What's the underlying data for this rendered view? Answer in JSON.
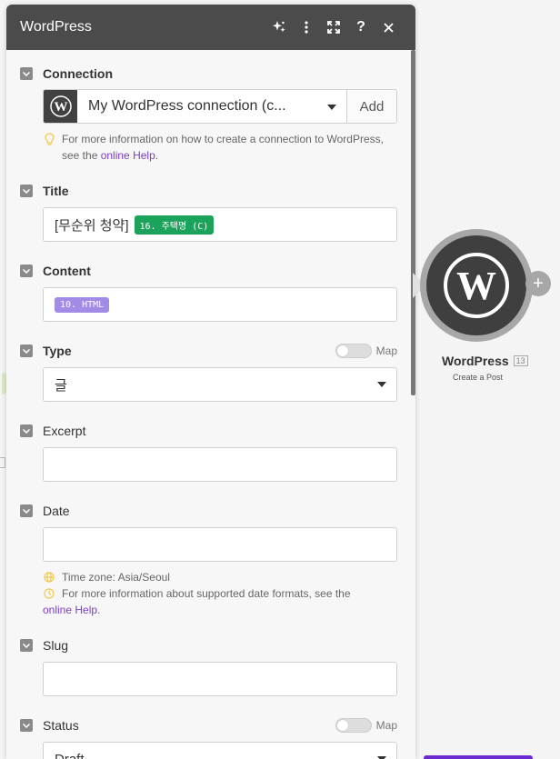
{
  "panel": {
    "title": "WordPress"
  },
  "connection": {
    "label": "Connection",
    "value": "My WordPress connection (c...",
    "add_label": "Add",
    "hint_text": "For more information on how to create a connection to WordPress, see the ",
    "hint_link": "online Help",
    "hint_end": "."
  },
  "title_field": {
    "label": "Title",
    "text": "[무순위 청약]",
    "pill": "16. 주택명 (C)"
  },
  "content_field": {
    "label": "Content",
    "pill": "10. HTML"
  },
  "type_field": {
    "label": "Type",
    "map_label": "Map",
    "value": "글"
  },
  "excerpt_field": {
    "label": "Excerpt",
    "value": ""
  },
  "date_field": {
    "label": "Date",
    "value": "",
    "timezone_hint": "Time zone: Asia/Seoul",
    "format_hint": "For more information about supported date formats, see the",
    "format_link": "online Help",
    "format_end": "."
  },
  "slug_field": {
    "label": "Slug",
    "value": ""
  },
  "status_field": {
    "label": "Status",
    "map_label": "Map",
    "value": "Draft"
  },
  "node": {
    "name": "WordPress",
    "badge": "13",
    "subtitle": "Create a Post"
  },
  "colors": {
    "header_bg": "#4b4b4b",
    "green_pill": "#1ba35b",
    "purple_pill": "#a08be6",
    "link": "#7b3fc4"
  }
}
